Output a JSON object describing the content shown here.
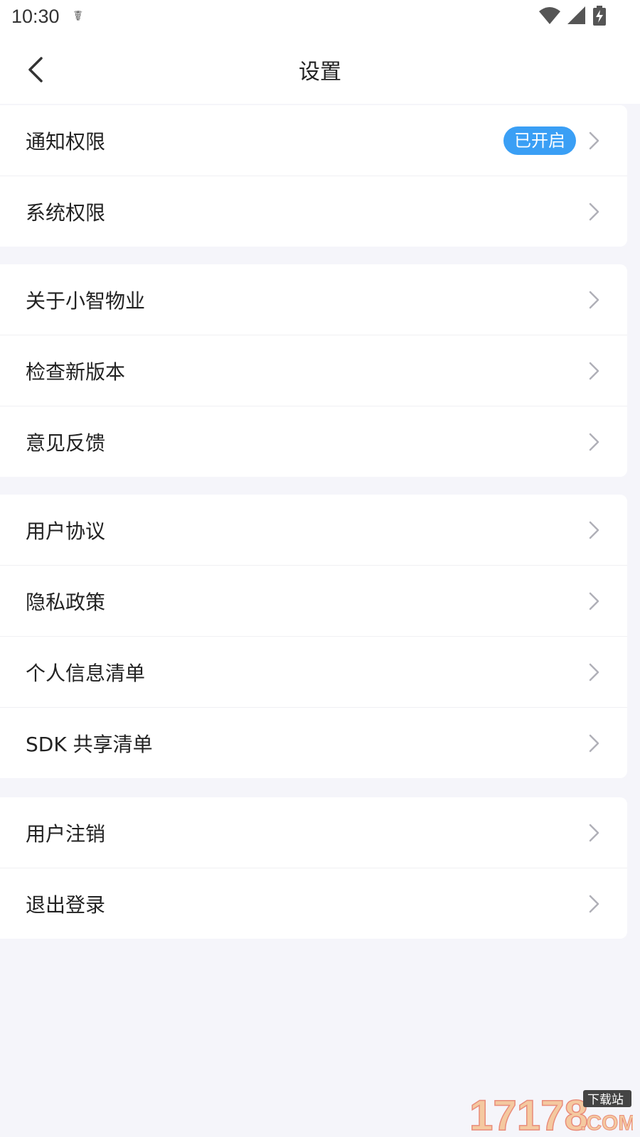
{
  "status_bar": {
    "time": "10:30",
    "usb_icon": "usb-debug-icon",
    "wifi_icon": "wifi-icon",
    "signal_icon": "cell-signal-icon",
    "battery_icon": "battery-charging-icon"
  },
  "header": {
    "back_icon": "chevron-left-icon",
    "title": "设置"
  },
  "groups": [
    {
      "items": [
        {
          "label": "通知权限",
          "badge": "已开启"
        },
        {
          "label": "系统权限"
        }
      ]
    },
    {
      "items": [
        {
          "label": "关于小智物业"
        },
        {
          "label": "检查新版本"
        },
        {
          "label": "意见反馈"
        }
      ]
    },
    {
      "items": [
        {
          "label": "用户协议"
        },
        {
          "label": "隐私政策"
        },
        {
          "label": "个人信息清单"
        },
        {
          "label": "SDK 共享清单"
        }
      ]
    },
    {
      "items": [
        {
          "label": "用户注销"
        },
        {
          "label": "退出登录"
        }
      ]
    }
  ],
  "watermark": {
    "text": "17178",
    "suffix": "下载站",
    "domain": ".COM"
  },
  "colors": {
    "accent": "#3a9ff5",
    "background": "#f5f5fa",
    "chevron": "#b0b0b8"
  }
}
